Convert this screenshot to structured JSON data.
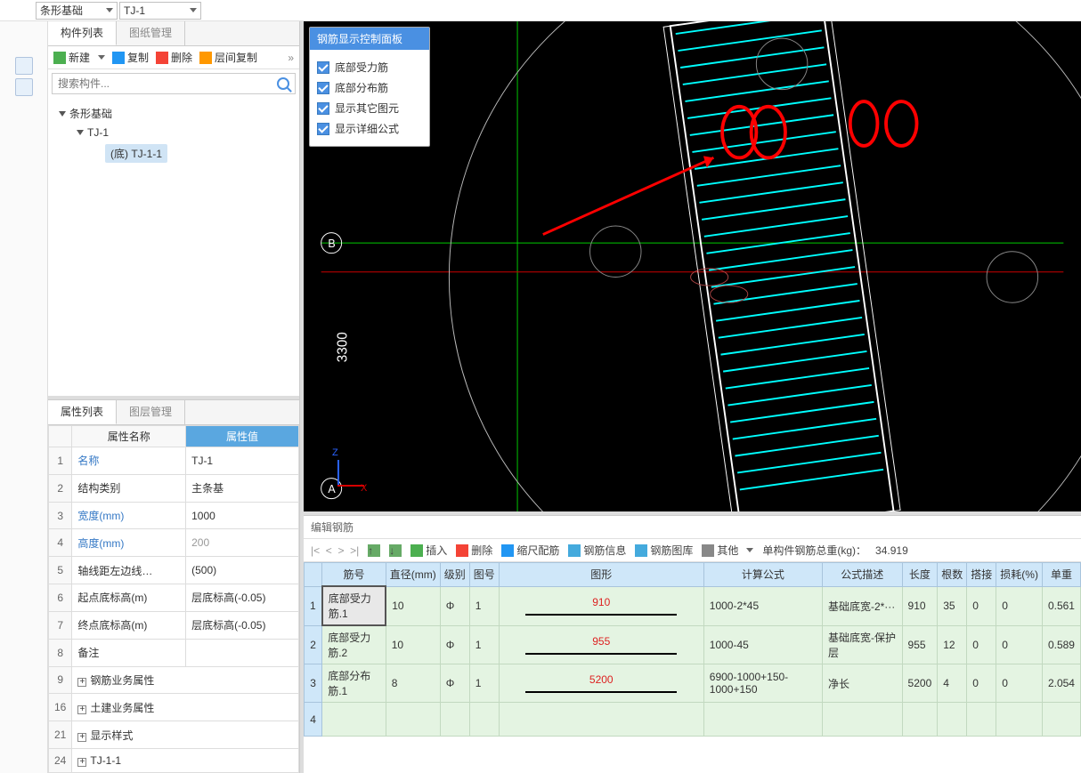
{
  "topbar": {
    "category_dd": "条形基础",
    "instance_dd": "TJ-1"
  },
  "left": {
    "tab_components": "构件列表",
    "tab_drawings": "图纸管理",
    "toolbar": {
      "new": "新建",
      "copy": "复制",
      "delete": "删除",
      "floor_copy": "层间复制"
    },
    "search_placeholder": "搜索构件...",
    "tree": {
      "root": "条形基础",
      "l1": "TJ-1",
      "l2": "(底) TJ-1-1"
    },
    "prop": {
      "tab_props": "属性列表",
      "tab_layers": "图层管理",
      "col_name": "属性名称",
      "col_value": "属性值",
      "rows": [
        {
          "n": "1",
          "name": "名称",
          "value": "TJ-1",
          "link": true
        },
        {
          "n": "2",
          "name": "结构类别",
          "value": "主条基"
        },
        {
          "n": "3",
          "name": "宽度(mm)",
          "value": "1000",
          "link": true
        },
        {
          "n": "4",
          "name": "高度(mm)",
          "value": "200",
          "link": true,
          "gray": true
        },
        {
          "n": "5",
          "name": "轴线距左边线…",
          "value": "(500)"
        },
        {
          "n": "6",
          "name": "起点底标高(m)",
          "value": "层底标高(-0.05)"
        },
        {
          "n": "7",
          "name": "终点底标高(m)",
          "value": "层底标高(-0.05)"
        },
        {
          "n": "8",
          "name": "备注",
          "value": ""
        },
        {
          "n": "9",
          "name": "钢筋业务属性",
          "expand": true
        },
        {
          "n": "16",
          "name": "土建业务属性",
          "expand": true
        },
        {
          "n": "21",
          "name": "显示样式",
          "expand": true
        },
        {
          "n": "24",
          "name": "TJ-1-1",
          "expand": true
        }
      ]
    }
  },
  "popup": {
    "title": "钢筋显示控制面板",
    "items": [
      "底部受力筋",
      "底部分布筋",
      "显示其它图元",
      "显示详细公式"
    ]
  },
  "canvas": {
    "dim_vert": "3300",
    "label_b": "B",
    "label_a": "A",
    "axis_z": "Z",
    "axis_x": "X"
  },
  "bottom": {
    "title": "编辑钢筋",
    "tb": {
      "insert": "插入",
      "delete": "删除",
      "scale": "缩尺配筋",
      "info": "钢筋信息",
      "library": "钢筋图库",
      "other": "其他",
      "total_label": "单构件钢筋总重(kg)：",
      "total_value": "34.919"
    },
    "headers": [
      "筋号",
      "直径(mm)",
      "级别",
      "图号",
      "图形",
      "计算公式",
      "公式描述",
      "长度",
      "根数",
      "搭接",
      "损耗(%)",
      "单重"
    ],
    "rows": [
      {
        "n": "1",
        "name": "底部受力筋.1",
        "dia": "10",
        "grade": "Φ",
        "pic": "1",
        "shape": "910",
        "formula": "1000-2*45",
        "desc": "基础底宽-2*···",
        "len": "910",
        "cnt": "35",
        "lap": "0",
        "loss": "0",
        "wt": "0.561"
      },
      {
        "n": "2",
        "name": "底部受力筋.2",
        "dia": "10",
        "grade": "Φ",
        "pic": "1",
        "shape": "955",
        "formula": "1000-45",
        "desc": "基础底宽-保护层",
        "len": "955",
        "cnt": "12",
        "lap": "0",
        "loss": "0",
        "wt": "0.589"
      },
      {
        "n": "3",
        "name": "底部分布筋.1",
        "dia": "8",
        "grade": "Φ",
        "pic": "1",
        "shape": "5200",
        "formula": "6900-1000+150-1000+150",
        "desc": "净长",
        "len": "5200",
        "cnt": "4",
        "lap": "0",
        "loss": "0",
        "wt": "2.054"
      },
      {
        "n": "4",
        "name": "",
        "dia": "",
        "grade": "",
        "pic": "",
        "shape": "",
        "formula": "",
        "desc": "",
        "len": "",
        "cnt": "",
        "lap": "",
        "loss": "",
        "wt": ""
      }
    ]
  }
}
